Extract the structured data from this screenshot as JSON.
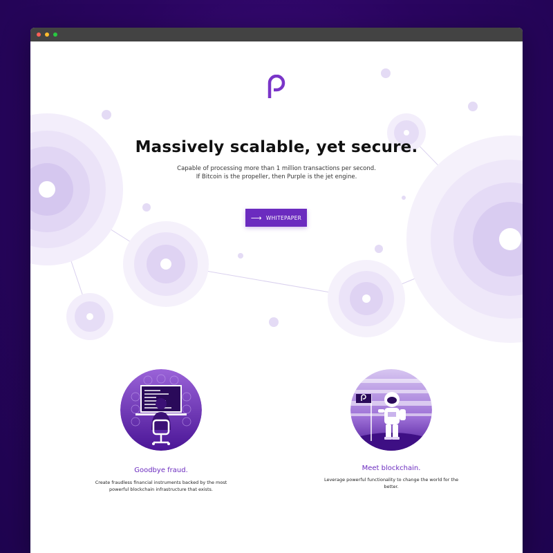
{
  "window": {
    "controls": [
      "close",
      "minimize",
      "maximize"
    ]
  },
  "brand": {
    "logo_icon": "purple-p-logo-icon",
    "accent_color": "#6b2bbf"
  },
  "hero": {
    "headline": "Massively scalable, yet secure.",
    "subline_1": "Capable of processing more than 1 million transactions per second.",
    "subline_2": "If Bitcoin is the propeller, then Purple is the jet engine.",
    "cta_label": "WHITEPAPER",
    "cta_icon": "arrow-right-icon"
  },
  "features": [
    {
      "illustration": "developer-at-computer-illustration",
      "title": "Goodbye fraud.",
      "description": "Create fraudless financial instruments backed by the most powerful blockchain infrastructure that exists."
    },
    {
      "illustration": "astronaut-with-flag-illustration",
      "title": "Meet blockchain.",
      "description": "Leverage powerful functionality to change the world for the better."
    }
  ]
}
